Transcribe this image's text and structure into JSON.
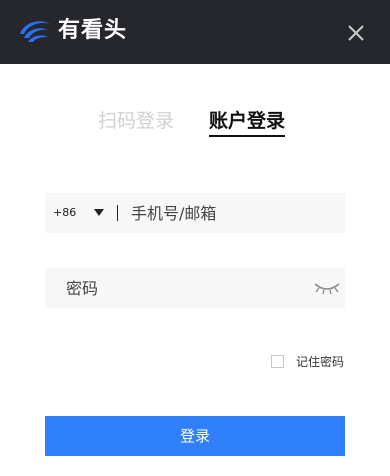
{
  "header": {
    "brand": "有看头",
    "logo_icon": "eye-swoosh-logo",
    "close_icon": "close-icon",
    "background": "#25272d"
  },
  "tabs": [
    {
      "label": "扫码登录",
      "active": false
    },
    {
      "label": "账户登录",
      "active": true
    }
  ],
  "form": {
    "country_code": "+86",
    "phone_placeholder": "手机号/邮箱",
    "phone_value": "",
    "password_placeholder": "密码",
    "password_value": "",
    "remember_label": "记住密码",
    "remember_checked": false,
    "submit_label": "登录"
  },
  "colors": {
    "accent": "#2f80fa",
    "logo": "#2a6ff5",
    "tab_inactive": "#d0d0d0"
  }
}
